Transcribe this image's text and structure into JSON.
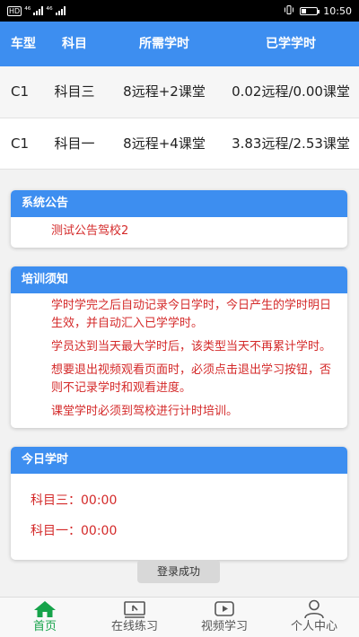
{
  "statusbar": {
    "hd": "HD",
    "network_1": "⁴⁶",
    "network_2": "⁴⁶",
    "battery_text": "",
    "time": "10:50"
  },
  "hours_table": {
    "headers": [
      "车型",
      "科目",
      "所需学时",
      "已学学时"
    ],
    "rows": [
      [
        "C1",
        "科目三",
        "8远程+2课堂",
        "0.02远程/0.00课堂"
      ],
      [
        "C1",
        "科目一",
        "8远程+4课堂",
        "3.83远程/2.53课堂"
      ]
    ]
  },
  "announcement": {
    "title": "系统公告",
    "items": [
      "测试公告驾校2"
    ]
  },
  "notice": {
    "title": "培训须知",
    "items": [
      "学时学完之后自动记录今日学时，今日产生的学时明日生效，并自动汇入已学学时。",
      "学员达到当天最大学时后，该类型当天不再累计学时。",
      "想要退出视频观看页面时，必须点击退出学习按钮，否则不记录学时和观看进度。",
      "课堂学时必须到驾校进行计时培训。"
    ]
  },
  "today": {
    "title": "今日学时",
    "rows": [
      {
        "label": "科目三：",
        "value": "00:00"
      },
      {
        "label": "科目一：",
        "value": "00:00"
      }
    ]
  },
  "toast": "登录成功",
  "tabs": [
    {
      "label": "首页",
      "icon": "home-icon"
    },
    {
      "label": "在线练习",
      "icon": "monitor-cursor-icon"
    },
    {
      "label": "视频学习",
      "icon": "video-play-icon"
    },
    {
      "label": "个人中心",
      "icon": "user-icon"
    }
  ],
  "colors": {
    "primary": "#3d8ef0",
    "alert_text": "#d42a2a",
    "active_tab": "#16a34a"
  }
}
